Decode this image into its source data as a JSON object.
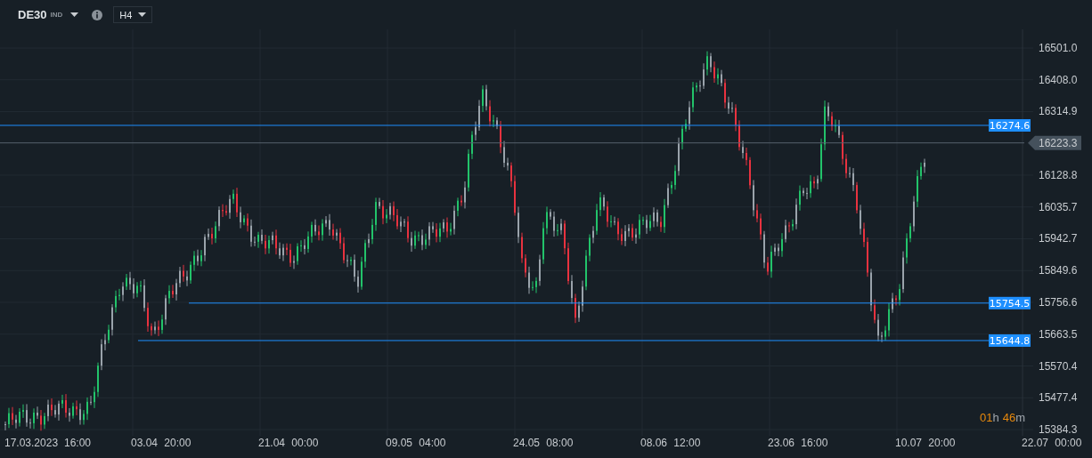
{
  "instrument": {
    "symbol": "DE30",
    "type": "IND"
  },
  "timeframe": "H4",
  "y_axis": {
    "ticks": [
      "16501.0",
      "16408.0",
      "16314.9",
      "16128.8",
      "16035.7",
      "15942.7",
      "15849.6",
      "15756.6",
      "15663.5",
      "15570.4",
      "15477.4",
      "15384.3"
    ]
  },
  "x_axis": {
    "labels": [
      {
        "date": "17.03.2023",
        "time": "16:00"
      },
      {
        "date": "03.04",
        "time": "20:00"
      },
      {
        "date": "21.04",
        "time": "00:00"
      },
      {
        "date": "09.05",
        "time": "04:00"
      },
      {
        "date": "24.05",
        "time": "08:00"
      },
      {
        "date": "08.06",
        "time": "12:00"
      },
      {
        "date": "23.06",
        "time": "16:00"
      },
      {
        "date": "10.07",
        "time": "20:00"
      },
      {
        "date": "22.07",
        "time": "00:00"
      }
    ]
  },
  "price_lines": [
    {
      "kind": "level",
      "label": "16274.6"
    },
    {
      "kind": "current",
      "label": "16223.3"
    },
    {
      "kind": "level",
      "label": "15754.5"
    },
    {
      "kind": "level",
      "label": "15644.8"
    }
  ],
  "countdown": {
    "hours": "01",
    "hours_unit": "h",
    "minutes": "46",
    "minutes_unit": "m"
  }
}
